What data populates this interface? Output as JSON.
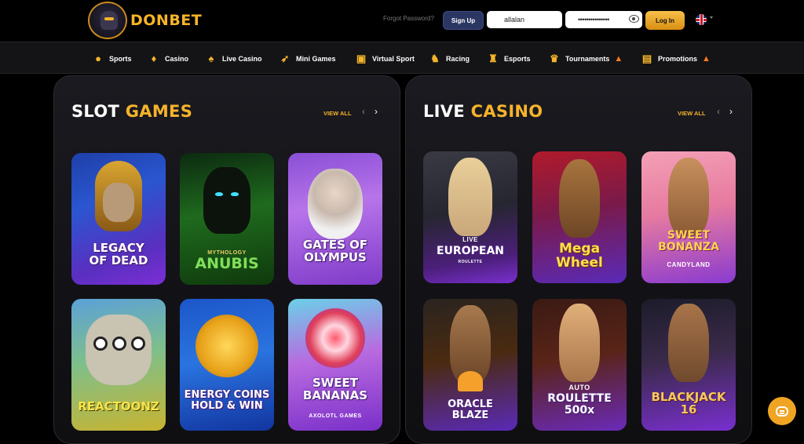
{
  "header": {
    "brand": "DONBET",
    "forgot_password": "Forgot Password?",
    "signup_label": "Sign Up",
    "username_value": "allalan",
    "password_value": "•••••••••••••••",
    "login_label": "Log In",
    "language": "English (UK flag)"
  },
  "nav": {
    "items": [
      {
        "label": "Sports",
        "icon": "basketball-icon"
      },
      {
        "label": "Casino",
        "icon": "money-bag-icon"
      },
      {
        "label": "Live Casino",
        "icon": "spade-icon"
      },
      {
        "label": "Mini Games",
        "icon": "rocket-icon"
      },
      {
        "label": "Virtual Sport",
        "icon": "gamepad-icon"
      },
      {
        "label": "Racing",
        "icon": "horse-icon"
      },
      {
        "label": "Esports",
        "icon": "soldier-icon"
      },
      {
        "label": "Tournaments",
        "icon": "trophy-icon"
      },
      {
        "label": "Promotions",
        "icon": "ticket-icon"
      }
    ]
  },
  "slots": {
    "title_white": "SLOT",
    "title_gold": "GAMES",
    "view_all": "VIEW ALL",
    "games": [
      {
        "line1": "LEGACY",
        "line2": "OF DEAD",
        "sub": ""
      },
      {
        "line1": "MYTHOLOGY",
        "line2": "ANUBIS",
        "sub": ""
      },
      {
        "line1": "GATES OF",
        "line2": "OLYMPUS",
        "sub": ""
      },
      {
        "line1": "REACTOONZ",
        "line2": "",
        "sub": ""
      },
      {
        "line1": "ENERGY COINS",
        "line2": "HOLD & WIN",
        "sub": ""
      },
      {
        "line1": "SWEET",
        "line2": "BANANAS",
        "sub": "AXOLOTL GAMES"
      }
    ]
  },
  "live": {
    "title_white": "LIVE",
    "title_gold": "CASINO",
    "view_all": "VIEW ALL",
    "games": [
      {
        "top": "LIVE",
        "line1": "EUROPEAN",
        "line2": "",
        "sub": "ROULETTE"
      },
      {
        "top": "",
        "line1": "Mega",
        "line2": "Wheel",
        "sub": ""
      },
      {
        "top": "",
        "line1": "SWEET",
        "line2": "BONANZA",
        "sub": "CANDYLAND"
      },
      {
        "top": "",
        "line1": "ORACLE",
        "line2": "BLAZE",
        "sub": ""
      },
      {
        "top": "AUTO",
        "line1": "ROULETTE",
        "line2": "500x",
        "sub": ""
      },
      {
        "top": "",
        "line1": "BLACKJACK",
        "line2": "16",
        "sub": ""
      }
    ]
  },
  "colors": {
    "accent": "#f5b32b",
    "signup": "#2b3663",
    "chat": "#f0a423"
  }
}
